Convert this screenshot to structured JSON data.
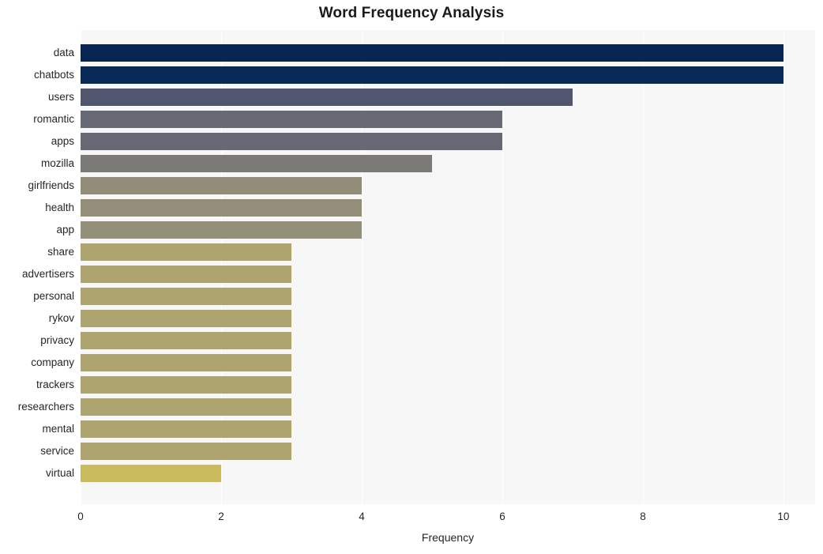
{
  "chart_data": {
    "type": "bar",
    "orientation": "horizontal",
    "title": "Word Frequency Analysis",
    "xlabel": "Frequency",
    "ylabel": "",
    "categories": [
      "data",
      "chatbots",
      "users",
      "romantic",
      "apps",
      "mozilla",
      "girlfriends",
      "health",
      "app",
      "share",
      "advertisers",
      "personal",
      "rykov",
      "privacy",
      "company",
      "trackers",
      "researchers",
      "mental",
      "service",
      "virtual"
    ],
    "values": [
      10,
      10,
      7,
      6,
      6,
      5,
      4,
      4,
      4,
      3,
      3,
      3,
      3,
      3,
      3,
      3,
      3,
      3,
      3,
      2
    ],
    "bar_colors": [
      "#062551",
      "#062955",
      "#4f566e",
      "#676a74",
      "#666973",
      "#7b7a77",
      "#918d78",
      "#938e79",
      "#948f79",
      "#ada470",
      "#ada470",
      "#ada470",
      "#ada470",
      "#ada470",
      "#ada470",
      "#ada470",
      "#ada470",
      "#ada470",
      "#ada470",
      "#cbbb5f"
    ],
    "xlim": [
      0,
      10.45
    ],
    "xticks": [
      0,
      2,
      4,
      6,
      8,
      10
    ],
    "xtick_labels": [
      "0",
      "2",
      "4",
      "6",
      "8",
      "10"
    ],
    "grid": true,
    "grid_axis": "x",
    "legend": false,
    "plot_background": "#f7f7f7",
    "figure_background": "#ffffff"
  }
}
